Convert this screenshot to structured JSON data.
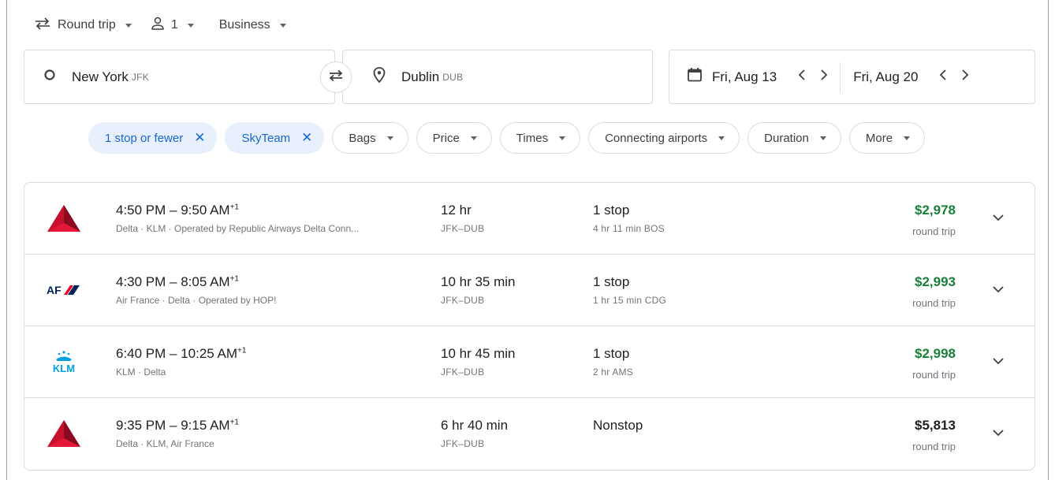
{
  "trip": {
    "type_label": "Round trip",
    "passengers": "1",
    "cabin": "Business"
  },
  "search": {
    "from_city": "New York",
    "from_code": "JFK",
    "to_city": "Dublin",
    "to_code": "DUB",
    "depart_date": "Fri, Aug 13",
    "return_date": "Fri, Aug 20"
  },
  "filters": {
    "active": [
      "1 stop or fewer",
      "SkyTeam"
    ],
    "dropdowns": [
      "Bags",
      "Price",
      "Times",
      "Connecting airports",
      "Duration",
      "More"
    ]
  },
  "flights": [
    {
      "logo": "delta-logo-icon",
      "times": "4:50 PM – 9:50 AM",
      "day_offset": "+1",
      "airlines": "Delta · KLM · Operated by Republic Airways Delta Conn...",
      "duration": "12 hr",
      "route": "JFK–DUB",
      "stops": "1 stop",
      "layover": "4 hr 11 min BOS",
      "price": "$2,978",
      "price_color": "#188038",
      "price_note": "round trip"
    },
    {
      "logo": "air-france-logo-icon",
      "times": "4:30 PM – 8:05 AM",
      "day_offset": "+1",
      "airlines": "Air France · Delta · Operated by HOP!",
      "duration": "10 hr 35 min",
      "route": "JFK–DUB",
      "stops": "1 stop",
      "layover": "1 hr 15 min CDG",
      "price": "$2,993",
      "price_color": "#188038",
      "price_note": "round trip"
    },
    {
      "logo": "klm-logo-icon",
      "times": "6:40 PM – 10:25 AM",
      "day_offset": "+1",
      "airlines": "KLM · Delta",
      "duration": "10 hr 45 min",
      "route": "JFK–DUB",
      "stops": "1 stop",
      "layover": "2 hr AMS",
      "price": "$2,998",
      "price_color": "#188038",
      "price_note": "round trip"
    },
    {
      "logo": "delta-logo-icon",
      "times": "9:35 PM – 9:15 AM",
      "day_offset": "+1",
      "airlines": "Delta · KLM, Air France",
      "duration": "6 hr 40 min",
      "route": "JFK–DUB",
      "stops": "Nonstop",
      "layover": "",
      "price": "$5,813",
      "price_color": "#202124",
      "price_note": "round trip"
    }
  ],
  "logos": {
    "air_france_text": "AF",
    "klm_text": "KLM"
  },
  "colors": {
    "accent": "#1967d2",
    "chip_active_bg": "#e8f0fe",
    "price_green": "#188038",
    "delta_red": "#c8102e",
    "air_france_navy": "#002157",
    "klm_blue": "#00a1de"
  }
}
